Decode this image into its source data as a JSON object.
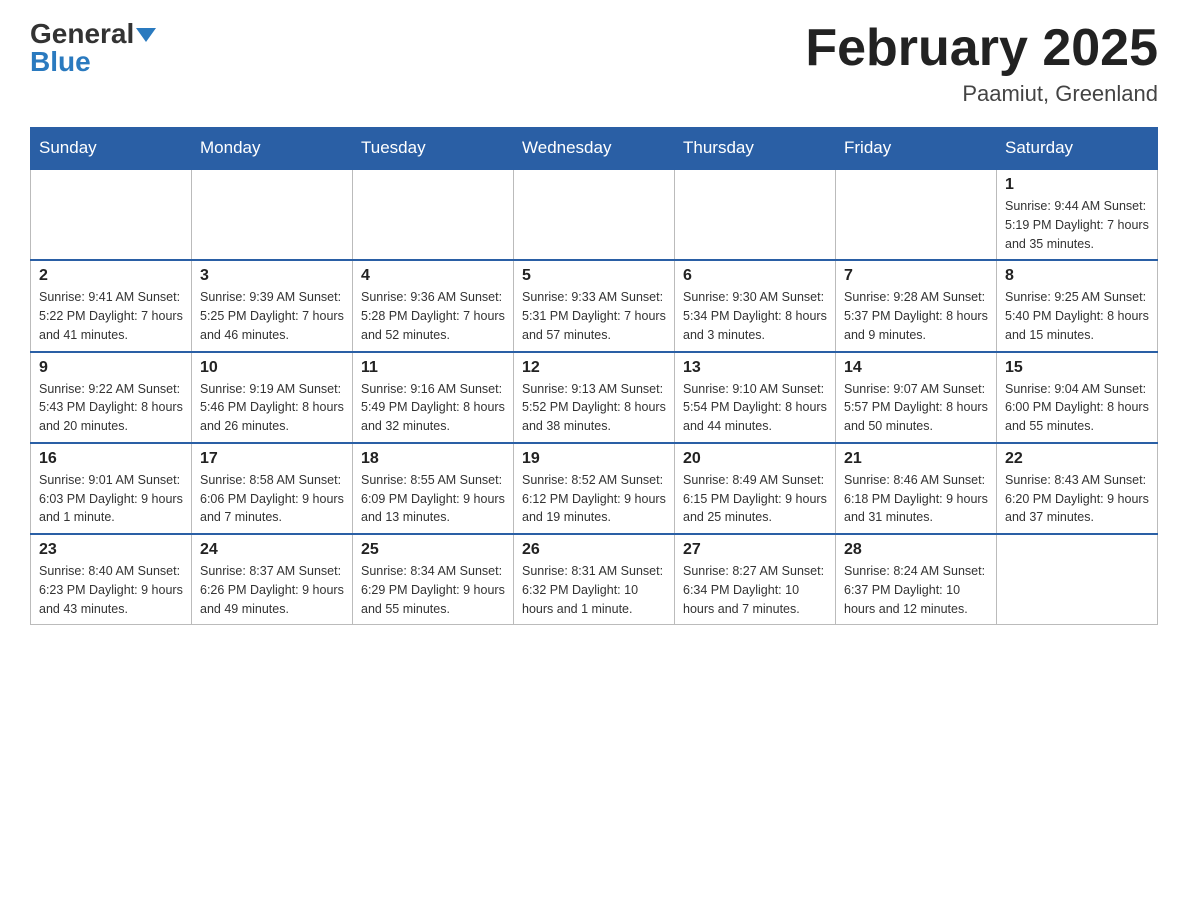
{
  "header": {
    "logo_general": "General",
    "logo_blue": "Blue",
    "title": "February 2025",
    "location": "Paamiut, Greenland"
  },
  "days_of_week": [
    "Sunday",
    "Monday",
    "Tuesday",
    "Wednesday",
    "Thursday",
    "Friday",
    "Saturday"
  ],
  "weeks": [
    {
      "days": [
        {
          "num": "",
          "info": "",
          "empty": true
        },
        {
          "num": "",
          "info": "",
          "empty": true
        },
        {
          "num": "",
          "info": "",
          "empty": true
        },
        {
          "num": "",
          "info": "",
          "empty": true
        },
        {
          "num": "",
          "info": "",
          "empty": true
        },
        {
          "num": "",
          "info": "",
          "empty": true
        },
        {
          "num": "1",
          "info": "Sunrise: 9:44 AM\nSunset: 5:19 PM\nDaylight: 7 hours\nand 35 minutes.",
          "empty": false
        }
      ]
    },
    {
      "days": [
        {
          "num": "2",
          "info": "Sunrise: 9:41 AM\nSunset: 5:22 PM\nDaylight: 7 hours\nand 41 minutes.",
          "empty": false
        },
        {
          "num": "3",
          "info": "Sunrise: 9:39 AM\nSunset: 5:25 PM\nDaylight: 7 hours\nand 46 minutes.",
          "empty": false
        },
        {
          "num": "4",
          "info": "Sunrise: 9:36 AM\nSunset: 5:28 PM\nDaylight: 7 hours\nand 52 minutes.",
          "empty": false
        },
        {
          "num": "5",
          "info": "Sunrise: 9:33 AM\nSunset: 5:31 PM\nDaylight: 7 hours\nand 57 minutes.",
          "empty": false
        },
        {
          "num": "6",
          "info": "Sunrise: 9:30 AM\nSunset: 5:34 PM\nDaylight: 8 hours\nand 3 minutes.",
          "empty": false
        },
        {
          "num": "7",
          "info": "Sunrise: 9:28 AM\nSunset: 5:37 PM\nDaylight: 8 hours\nand 9 minutes.",
          "empty": false
        },
        {
          "num": "8",
          "info": "Sunrise: 9:25 AM\nSunset: 5:40 PM\nDaylight: 8 hours\nand 15 minutes.",
          "empty": false
        }
      ]
    },
    {
      "days": [
        {
          "num": "9",
          "info": "Sunrise: 9:22 AM\nSunset: 5:43 PM\nDaylight: 8 hours\nand 20 minutes.",
          "empty": false
        },
        {
          "num": "10",
          "info": "Sunrise: 9:19 AM\nSunset: 5:46 PM\nDaylight: 8 hours\nand 26 minutes.",
          "empty": false
        },
        {
          "num": "11",
          "info": "Sunrise: 9:16 AM\nSunset: 5:49 PM\nDaylight: 8 hours\nand 32 minutes.",
          "empty": false
        },
        {
          "num": "12",
          "info": "Sunrise: 9:13 AM\nSunset: 5:52 PM\nDaylight: 8 hours\nand 38 minutes.",
          "empty": false
        },
        {
          "num": "13",
          "info": "Sunrise: 9:10 AM\nSunset: 5:54 PM\nDaylight: 8 hours\nand 44 minutes.",
          "empty": false
        },
        {
          "num": "14",
          "info": "Sunrise: 9:07 AM\nSunset: 5:57 PM\nDaylight: 8 hours\nand 50 minutes.",
          "empty": false
        },
        {
          "num": "15",
          "info": "Sunrise: 9:04 AM\nSunset: 6:00 PM\nDaylight: 8 hours\nand 55 minutes.",
          "empty": false
        }
      ]
    },
    {
      "days": [
        {
          "num": "16",
          "info": "Sunrise: 9:01 AM\nSunset: 6:03 PM\nDaylight: 9 hours\nand 1 minute.",
          "empty": false
        },
        {
          "num": "17",
          "info": "Sunrise: 8:58 AM\nSunset: 6:06 PM\nDaylight: 9 hours\nand 7 minutes.",
          "empty": false
        },
        {
          "num": "18",
          "info": "Sunrise: 8:55 AM\nSunset: 6:09 PM\nDaylight: 9 hours\nand 13 minutes.",
          "empty": false
        },
        {
          "num": "19",
          "info": "Sunrise: 8:52 AM\nSunset: 6:12 PM\nDaylight: 9 hours\nand 19 minutes.",
          "empty": false
        },
        {
          "num": "20",
          "info": "Sunrise: 8:49 AM\nSunset: 6:15 PM\nDaylight: 9 hours\nand 25 minutes.",
          "empty": false
        },
        {
          "num": "21",
          "info": "Sunrise: 8:46 AM\nSunset: 6:18 PM\nDaylight: 9 hours\nand 31 minutes.",
          "empty": false
        },
        {
          "num": "22",
          "info": "Sunrise: 8:43 AM\nSunset: 6:20 PM\nDaylight: 9 hours\nand 37 minutes.",
          "empty": false
        }
      ]
    },
    {
      "days": [
        {
          "num": "23",
          "info": "Sunrise: 8:40 AM\nSunset: 6:23 PM\nDaylight: 9 hours\nand 43 minutes.",
          "empty": false
        },
        {
          "num": "24",
          "info": "Sunrise: 8:37 AM\nSunset: 6:26 PM\nDaylight: 9 hours\nand 49 minutes.",
          "empty": false
        },
        {
          "num": "25",
          "info": "Sunrise: 8:34 AM\nSunset: 6:29 PM\nDaylight: 9 hours\nand 55 minutes.",
          "empty": false
        },
        {
          "num": "26",
          "info": "Sunrise: 8:31 AM\nSunset: 6:32 PM\nDaylight: 10 hours\nand 1 minute.",
          "empty": false
        },
        {
          "num": "27",
          "info": "Sunrise: 8:27 AM\nSunset: 6:34 PM\nDaylight: 10 hours\nand 7 minutes.",
          "empty": false
        },
        {
          "num": "28",
          "info": "Sunrise: 8:24 AM\nSunset: 6:37 PM\nDaylight: 10 hours\nand 12 minutes.",
          "empty": false
        },
        {
          "num": "",
          "info": "",
          "empty": true
        }
      ]
    }
  ]
}
